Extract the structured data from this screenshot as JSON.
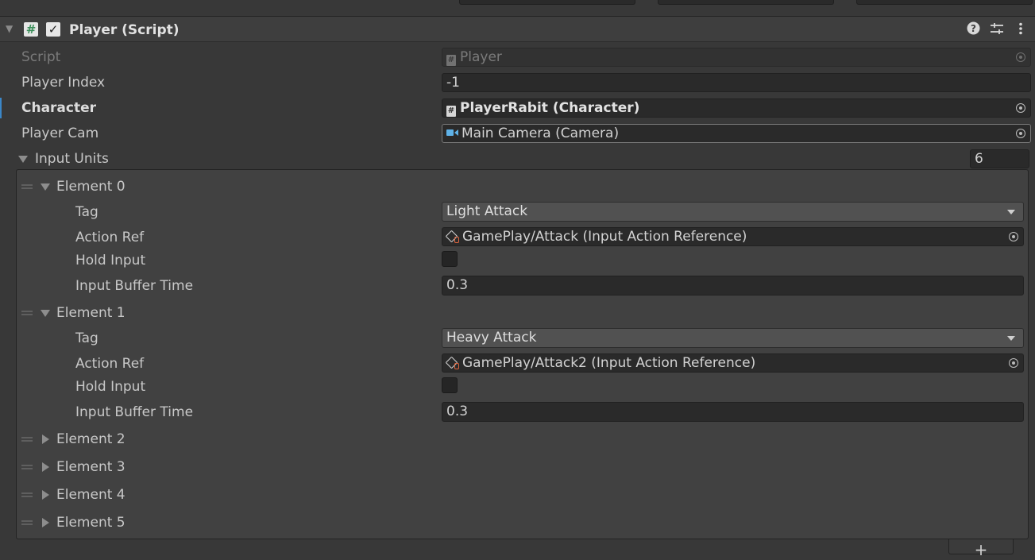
{
  "component": {
    "title": "Player (Script)",
    "enabled": true
  },
  "fields": {
    "script": {
      "label": "Script",
      "value": "Player"
    },
    "player_index": {
      "label": "Player Index",
      "value": "-1"
    },
    "character": {
      "label": "Character",
      "value": "PlayerRabit (Character)"
    },
    "player_cam": {
      "label": "Player Cam",
      "value": "Main Camera (Camera)"
    }
  },
  "input_units": {
    "label": "Input Units",
    "size": "6",
    "elements": [
      {
        "label": "Element 0",
        "expanded": true,
        "tag_label": "Tag",
        "tag": "Light Attack",
        "action_label": "Action Ref",
        "action": "GamePlay/Attack (Input Action Reference)",
        "hold_label": "Hold Input",
        "hold": false,
        "buffer_label": "Input Buffer Time",
        "buffer": "0.3"
      },
      {
        "label": "Element 1",
        "expanded": true,
        "tag_label": "Tag",
        "tag": "Heavy Attack",
        "action_label": "Action Ref",
        "action": "GamePlay/Attack2 (Input Action Reference)",
        "hold_label": "Hold Input",
        "hold": false,
        "buffer_label": "Input Buffer Time",
        "buffer": "0.3"
      },
      {
        "label": "Element 2",
        "expanded": false
      },
      {
        "label": "Element 3",
        "expanded": false
      },
      {
        "label": "Element 4",
        "expanded": false
      },
      {
        "label": "Element 5",
        "expanded": false
      }
    ],
    "add_label": "+"
  },
  "icons": {
    "header": [
      "foldout-arrow-icon",
      "script-icon",
      "checkbox-icon",
      "help-icon",
      "presets-icon",
      "more-menu-icon"
    ],
    "accent_color": "#3b87c8",
    "camera_icon_color": "#5fb2e8"
  }
}
